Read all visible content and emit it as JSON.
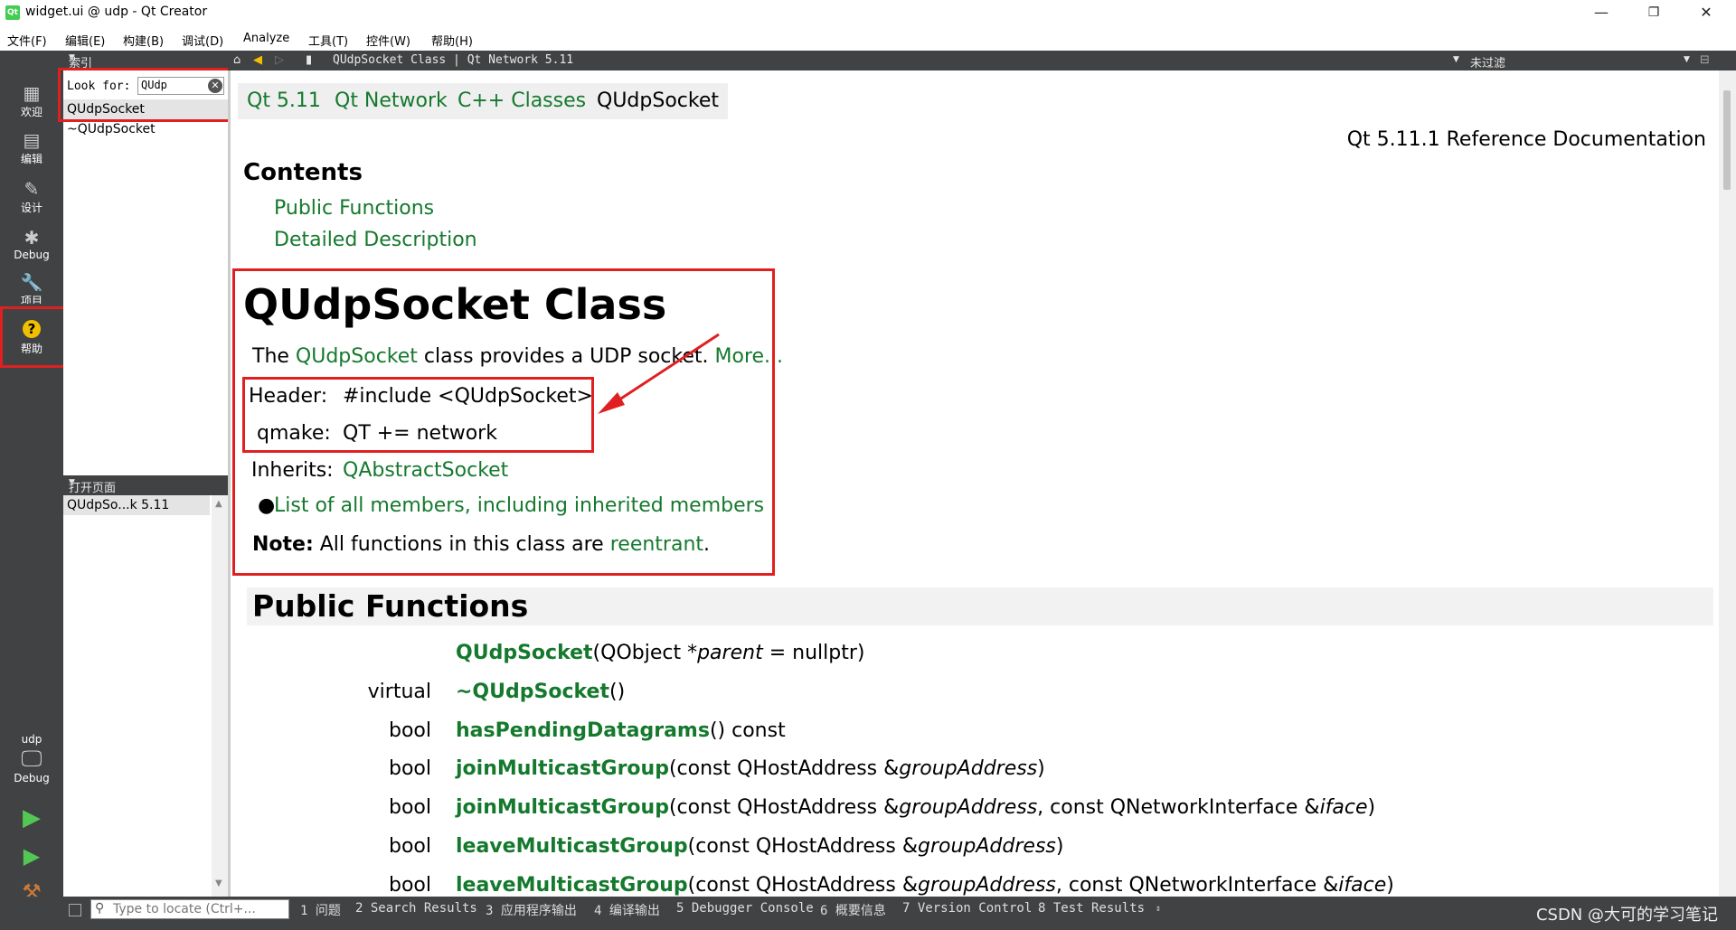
{
  "window": {
    "app_icon": "Qt",
    "title": "widget.ui @ udp - Qt Creator",
    "minimize": "—",
    "maximize": "❐",
    "close": "✕"
  },
  "menubar": [
    "文件(F)",
    "编辑(E)",
    "构建(B)",
    "调试(D)",
    "Analyze",
    "工具(T)",
    "控件(W)",
    "帮助(H)"
  ],
  "modes": {
    "welcome": "欢迎",
    "edit": "编辑",
    "design": "设计",
    "debug": "Debug",
    "projects": "项目",
    "help": "帮助",
    "help_icon": "?",
    "kit_project": "udp",
    "kit_build": "Debug"
  },
  "index_panel": {
    "header": "索引",
    "look_for_label": "Look for:",
    "look_for_value": "QUdp",
    "results": [
      "QUdpSocket",
      "~QUdpSocket"
    ]
  },
  "open_pages": {
    "header": "打开页面",
    "items": [
      "QUdpSo...k 5.11"
    ]
  },
  "content_toolbar": {
    "page_title": "QUdpSocket Class | Qt Network 5.11",
    "filter": "未过滤"
  },
  "doc": {
    "breadcrumbs": [
      "Qt 5.11",
      "Qt Network",
      "C++ Classes",
      "QUdpSocket"
    ],
    "ref_doc": "Qt 5.11.1 Reference Documentation",
    "contents_heading": "Contents",
    "toc": [
      "Public Functions",
      "Detailed Description"
    ],
    "class_title": "QUdpSocket Class",
    "brief_pre": "The ",
    "brief_link": "QUdpSocket",
    "brief_mid": " class provides a UDP socket. ",
    "brief_more": "More...",
    "header_label": "Header:",
    "header_value": "#include <QUdpSocket>",
    "qmake_label": "qmake:",
    "qmake_value": "QT += network",
    "inherits_label": "Inherits:",
    "inherits_value": "QAbstractSocket",
    "members_link": "List of all members, including inherited members",
    "note_label": "Note:",
    "note_text": " All functions in this class are ",
    "note_link": "reentrant",
    "note_end": ".",
    "public_functions_heading": "Public Functions",
    "functions": [
      {
        "type": "",
        "name": "QUdpSocket",
        "pre": "(QObject *",
        "arg": "parent",
        "post": " = nullptr)"
      },
      {
        "type": "virtual",
        "name": "~QUdpSocket",
        "pre": "()",
        "arg": "",
        "post": ""
      },
      {
        "type": "bool",
        "name": "hasPendingDatagrams",
        "pre": "() const",
        "arg": "",
        "post": ""
      },
      {
        "type": "bool",
        "name": "joinMulticastGroup",
        "pre": "(const QHostAddress &",
        "arg": "groupAddress",
        "post": ")"
      },
      {
        "type": "bool",
        "name": "joinMulticastGroup",
        "pre": "(const QHostAddress &",
        "arg": "groupAddress",
        "post": ", const QNetworkInterface &",
        "arg2": "iface",
        "post2": ")"
      },
      {
        "type": "bool",
        "name": "leaveMulticastGroup",
        "pre": "(const QHostAddress &",
        "arg": "groupAddress",
        "post": ")"
      },
      {
        "type": "bool",
        "name": "leaveMulticastGroup",
        "pre": "(const QHostAddress &",
        "arg": "groupAddress",
        "post": ", const QNetworkInterface &",
        "arg2": "iface",
        "post2": ")"
      }
    ]
  },
  "statusbar": {
    "locate_placeholder": "Type to locate (Ctrl+...",
    "tabs": [
      "1 问题",
      "2 Search Results",
      "3 应用程序输出",
      "4 编译输出",
      "5 Debugger Console",
      "6 概要信息",
      "7 Version Control",
      "8 Test Results"
    ],
    "watermark": "CSDN @大可的学习笔记"
  },
  "colors": {
    "link_green": "#15792d",
    "sidebar_dark": "#404244",
    "highlight_red": "#e02020"
  }
}
